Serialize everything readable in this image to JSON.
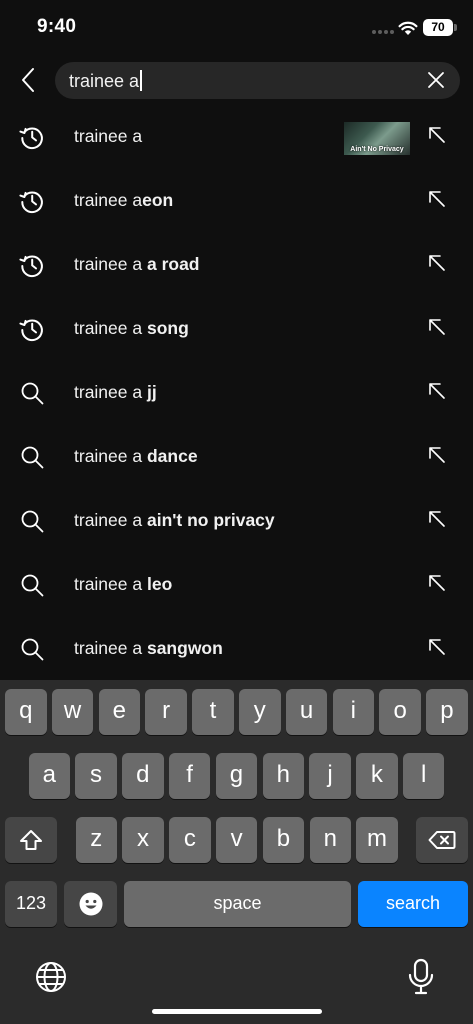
{
  "status_bar": {
    "time": "9:40",
    "battery_level": "70"
  },
  "search": {
    "query": "trainee a"
  },
  "suggestions": [
    {
      "icon": "history-icon",
      "prefix": "trainee a",
      "suffix": "",
      "thumbnail_text": "Ain't No Privacy"
    },
    {
      "icon": "history-icon",
      "prefix": "trainee a",
      "suffix": "eon"
    },
    {
      "icon": "history-icon",
      "prefix": "trainee a ",
      "suffix": "a road"
    },
    {
      "icon": "history-icon",
      "prefix": "trainee a ",
      "suffix": "song"
    },
    {
      "icon": "search-icon",
      "prefix": "trainee a ",
      "suffix": "jj"
    },
    {
      "icon": "search-icon",
      "prefix": "trainee a ",
      "suffix": "dance"
    },
    {
      "icon": "search-icon",
      "prefix": "trainee a ",
      "suffix": "ain't no privacy"
    },
    {
      "icon": "search-icon",
      "prefix": "trainee a ",
      "suffix": "leo"
    },
    {
      "icon": "search-icon",
      "prefix": "trainee a ",
      "suffix": "sangwon"
    }
  ],
  "keyboard": {
    "row1": [
      "q",
      "w",
      "e",
      "r",
      "t",
      "y",
      "u",
      "i",
      "o",
      "p"
    ],
    "row2": [
      "a",
      "s",
      "d",
      "f",
      "g",
      "h",
      "j",
      "k",
      "l"
    ],
    "row3": [
      "z",
      "x",
      "c",
      "v",
      "b",
      "n",
      "m"
    ],
    "numbers_label": "123",
    "space_label": "space",
    "search_label": "search"
  },
  "colors": {
    "background": "#0f0f0f",
    "search_box": "#272727",
    "keyboard_bg": "#2b2b2b",
    "key": "#6b6b6b",
    "key_dark": "#464646",
    "accent": "#0a84ff"
  }
}
